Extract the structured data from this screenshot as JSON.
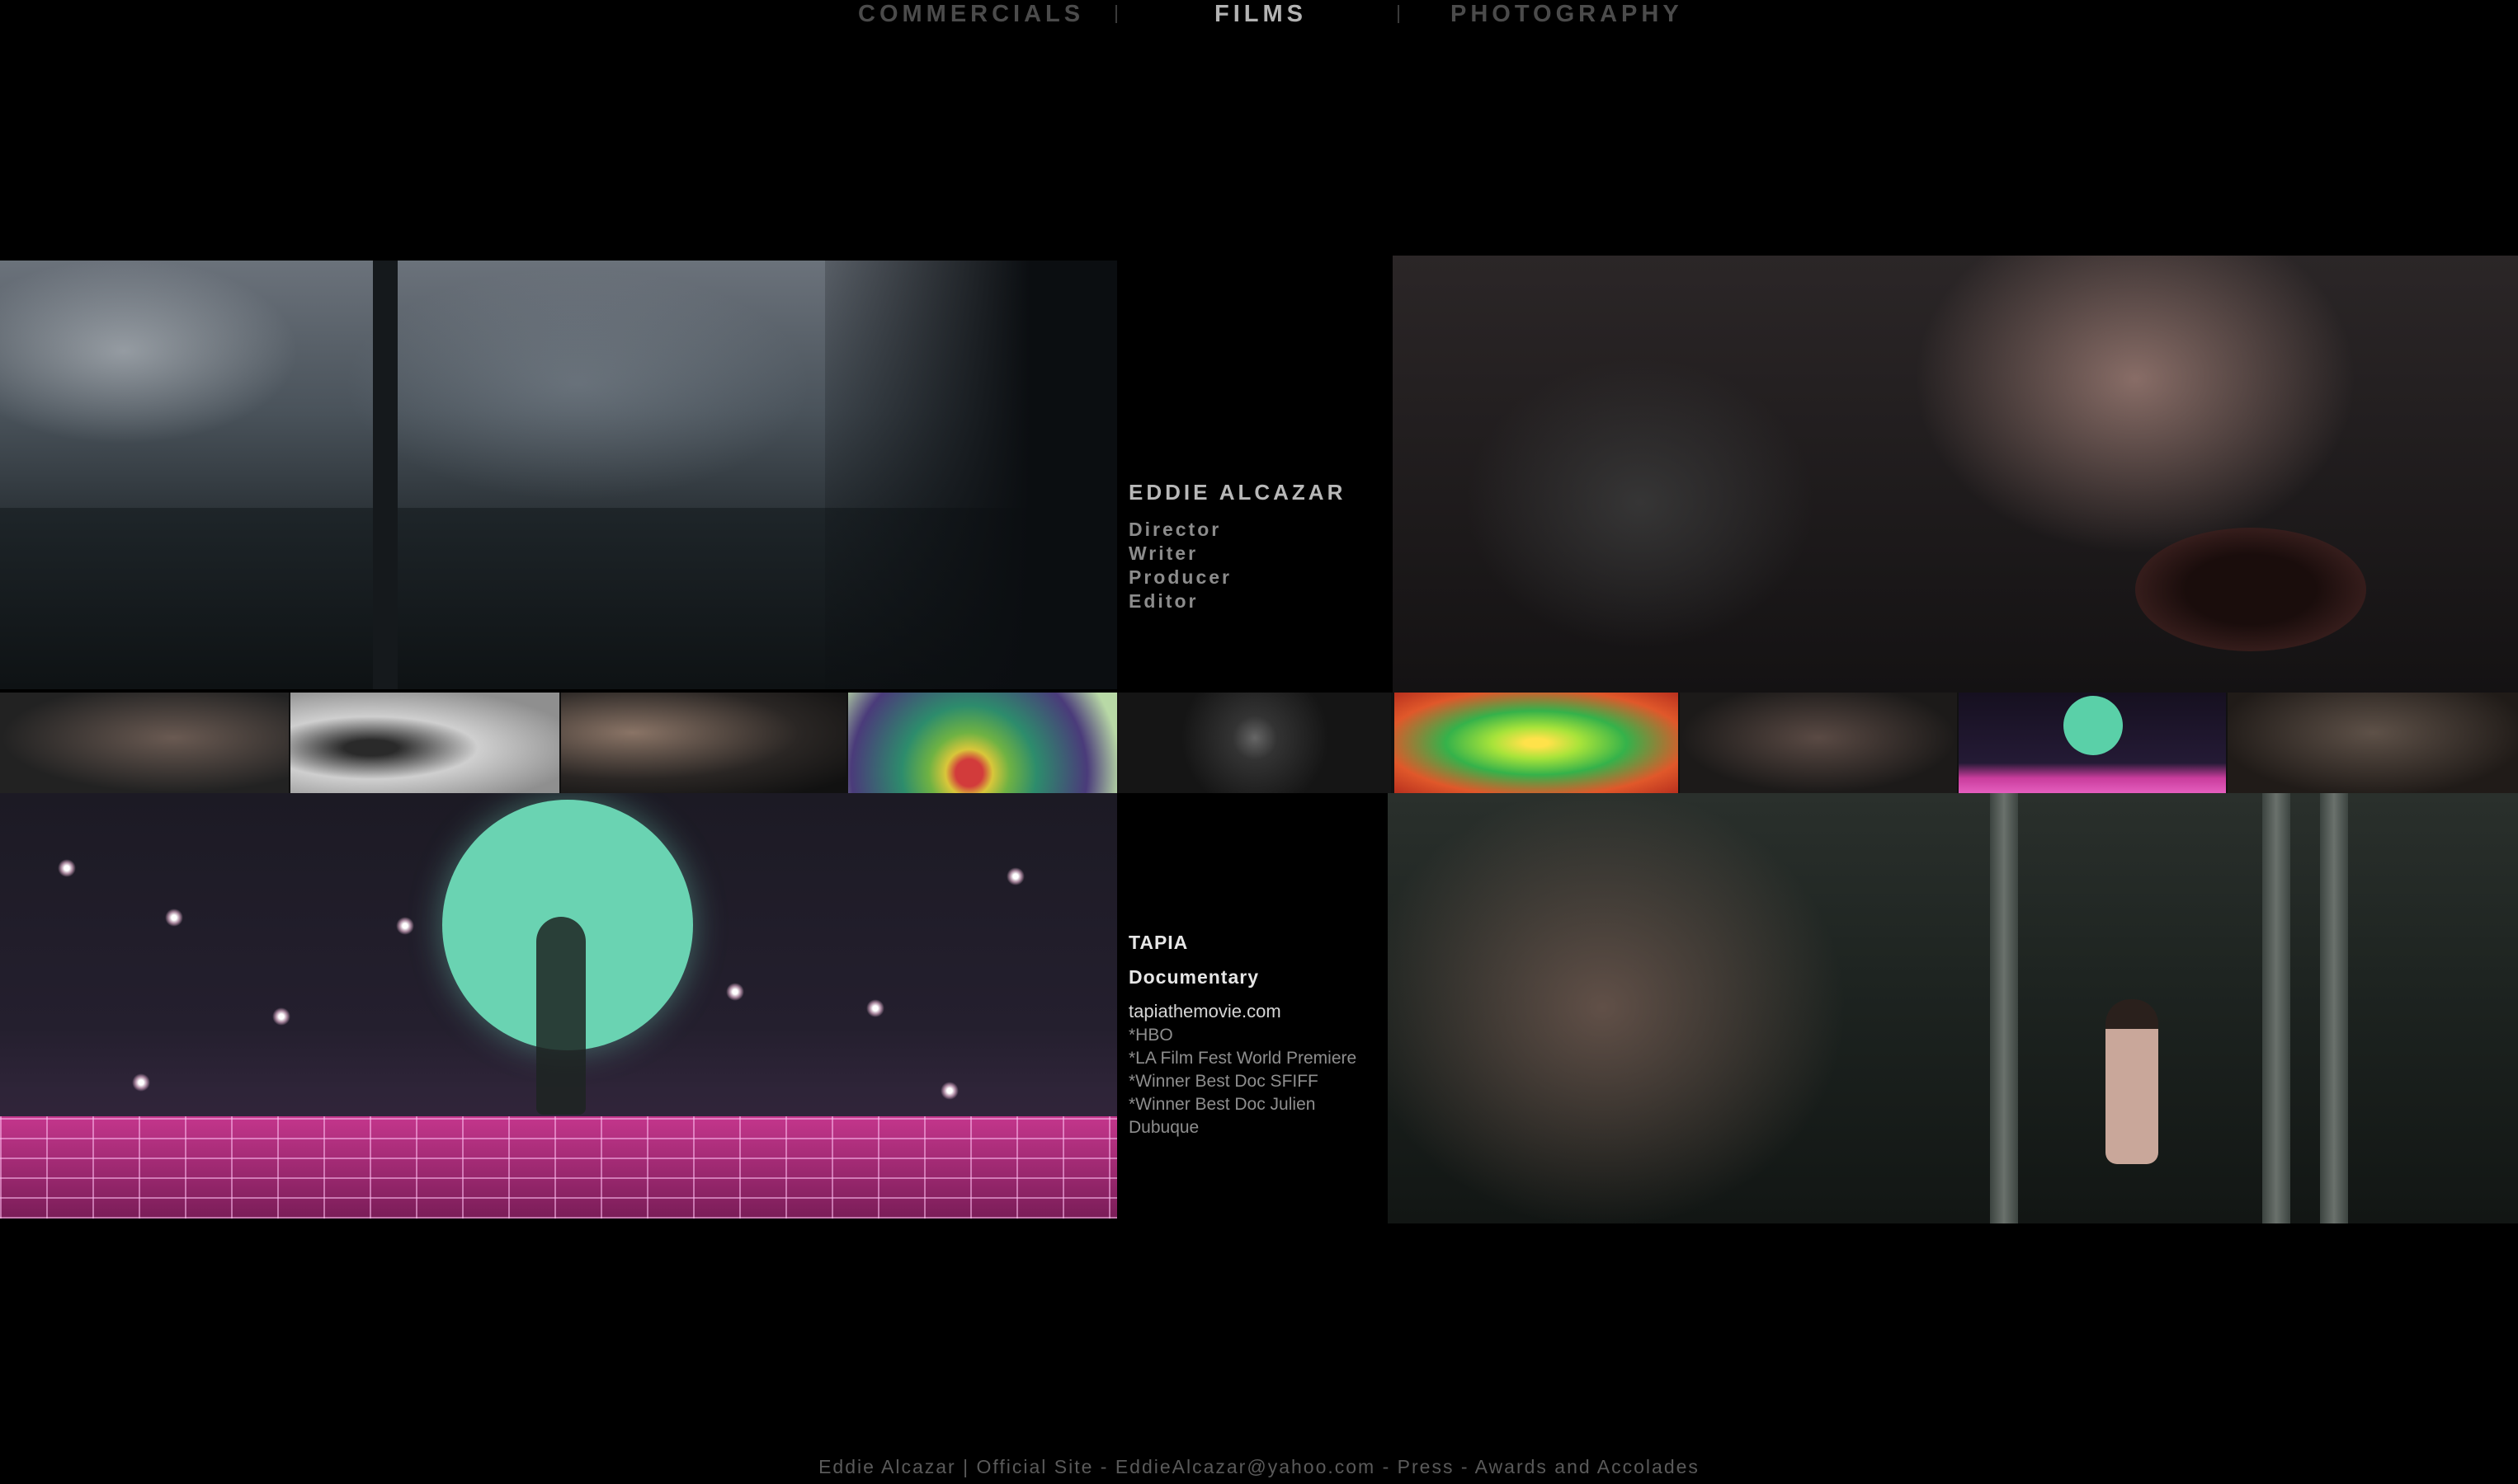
{
  "nav": {
    "items": [
      {
        "label": "COMMERCIALS"
      },
      {
        "label": "FILMS"
      },
      {
        "label": "PHOTOGRAPHY"
      }
    ],
    "separator": "|",
    "active": "FILMS"
  },
  "profile": {
    "name": "EDDIE ALCAZAR",
    "roles": [
      "Director",
      "Writer",
      "Producer",
      "Editor"
    ]
  },
  "film": {
    "title": "TAPIA",
    "type": "Documentary",
    "link": "tapiathemovie.com",
    "notes": [
      "*HBO",
      "*LA Film Fest World Premiere",
      "*Winner Best Doc SFIFF",
      "*Winner Best Doc Julien Dubuque"
    ]
  },
  "footer": {
    "site": "Eddie Alcazar | Official Site",
    "sep": " - ",
    "email": "EddieAlcazar@yahoo.com",
    "press": "Press",
    "awards": "Awards and Accolades"
  },
  "colors": {
    "background": "#000000",
    "nav_active": "#b3b3b3",
    "nav_inactive": "#4b4b4b",
    "moon": "#6ad3b2",
    "grid_pink": "#c4368c"
  }
}
